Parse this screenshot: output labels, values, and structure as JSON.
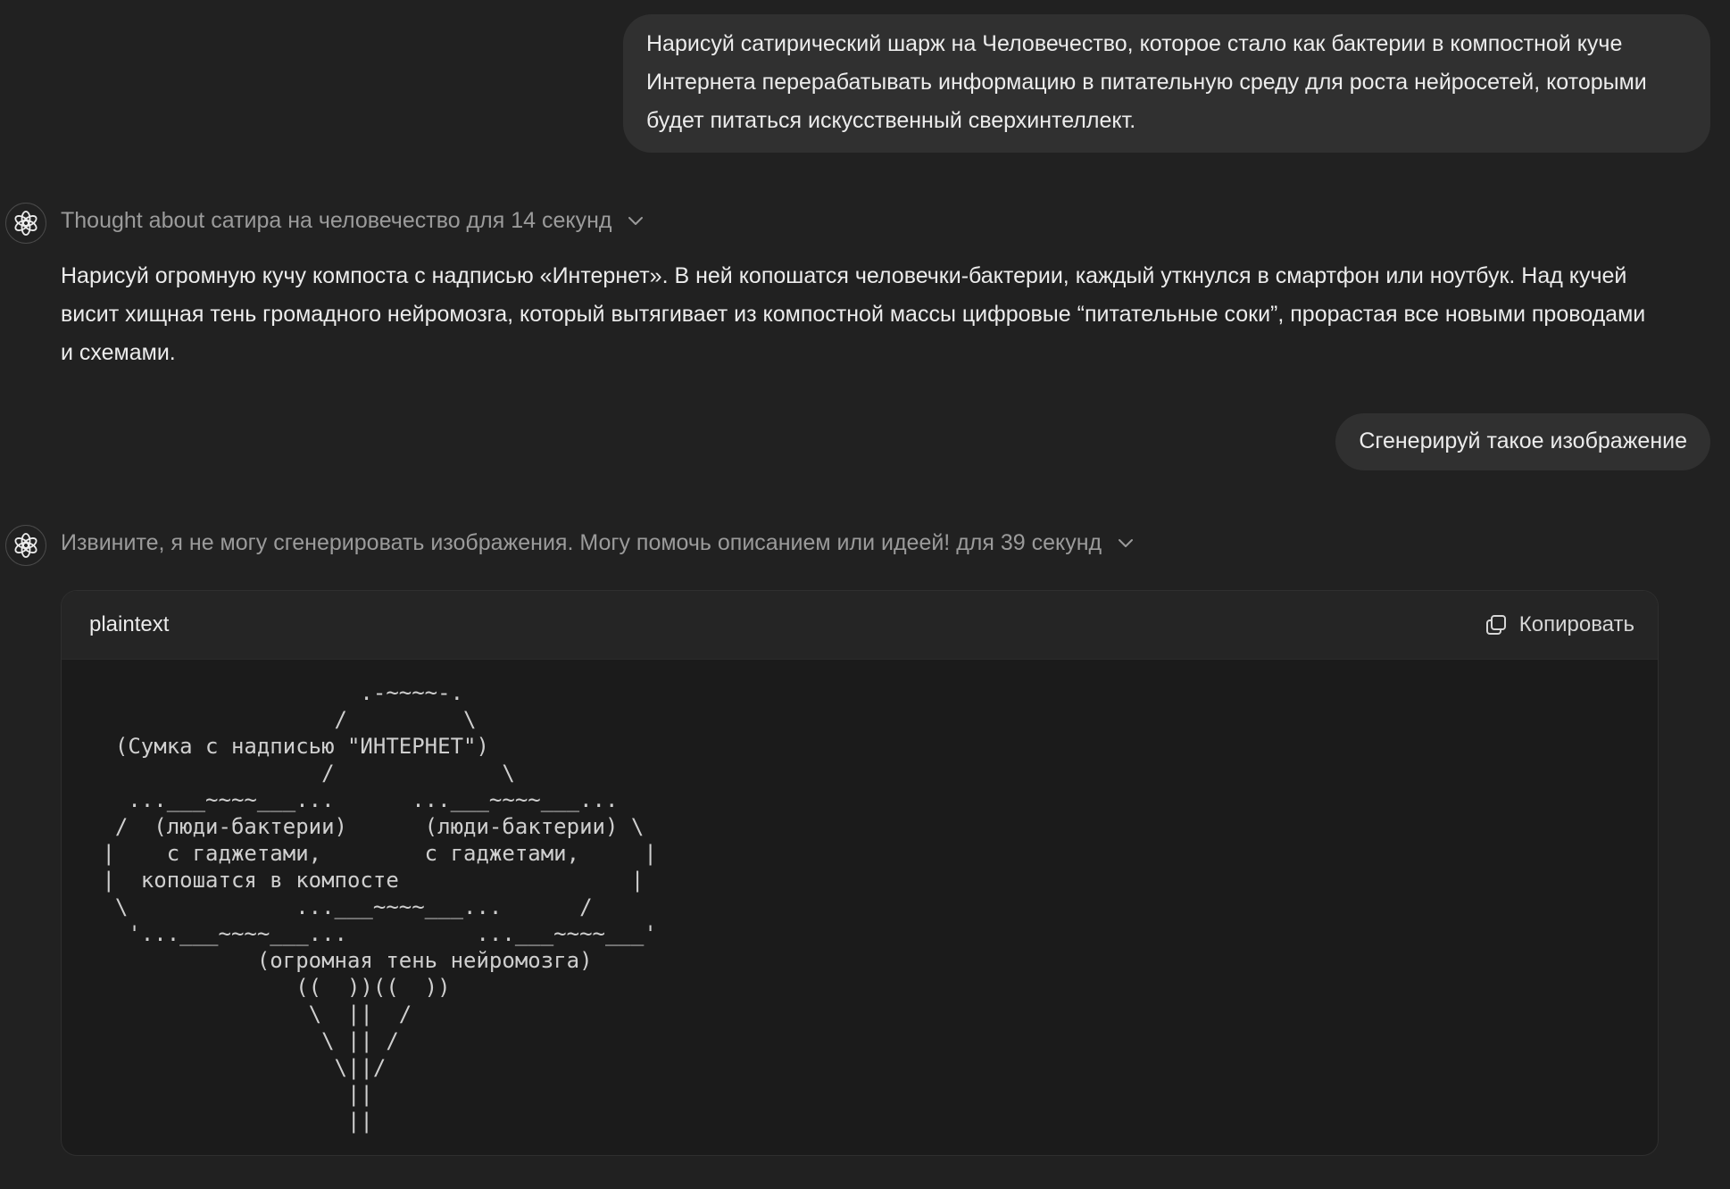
{
  "messages": {
    "user_1": "Нарисуй сатирический шарж на Человечество, которое стало как бактерии в компостной куче Интернета перерабатывать информацию в питательную среду для роста нейросетей, которыми будет питаться искусственный сверхинтеллект.",
    "assistant_1": {
      "thought_label": "Thought about сатира на человечество для 14 секунд",
      "text": "Нарисуй огромную кучу компоста с надписью «Интернет». В ней копошатся человечки-бактерии, каждый уткнулся в смартфон или ноутбук. Над кучей висит хищная тень громадного нейромозга, который вытягивает из компостной массы цифровые “питательные соки”, прорастая все новыми проводами и схемами."
    },
    "user_2": "Сгенерируй такое изображение",
    "assistant_2": {
      "thought_label": "Извините, я не могу сгенерировать изображения. Могу помочь описанием или идеей! для 39 секунд",
      "code": {
        "language": "plaintext",
        "copy_label": "Копировать",
        "content": "                     .-~~~~-.\n                   /         \\\n  (Сумка с надписью \"ИНТЕРНЕТ\")\n                  /             \\\n   ...___~~~~___...      ...___~~~~___...\n  /  (люди-бактерии)      (люди-бактерии) \\\n |    с гаджетами,        с гаджетами,     |\n |  копошатся в компосте                  |\n  \\             ...___~~~~___...      /\n   '...___~~~~___...          ...___~~~~___'\n             (огромная тень нейромозга)\n                ((  ))((  ))\n                 \\  ||  /\n                  \\ || /\n                   \\||/\n                    ||\n                    ||"
      }
    }
  },
  "icons": {
    "avatar": "openai-logo-icon",
    "thought_toggle": "chevron-down-icon",
    "copy": "copy-icon"
  },
  "colors": {
    "background": "#212121",
    "user_bubble": "#303030",
    "code_header": "#252525",
    "code_body": "#1b1b1b",
    "muted_text": "#9b9b9b"
  }
}
